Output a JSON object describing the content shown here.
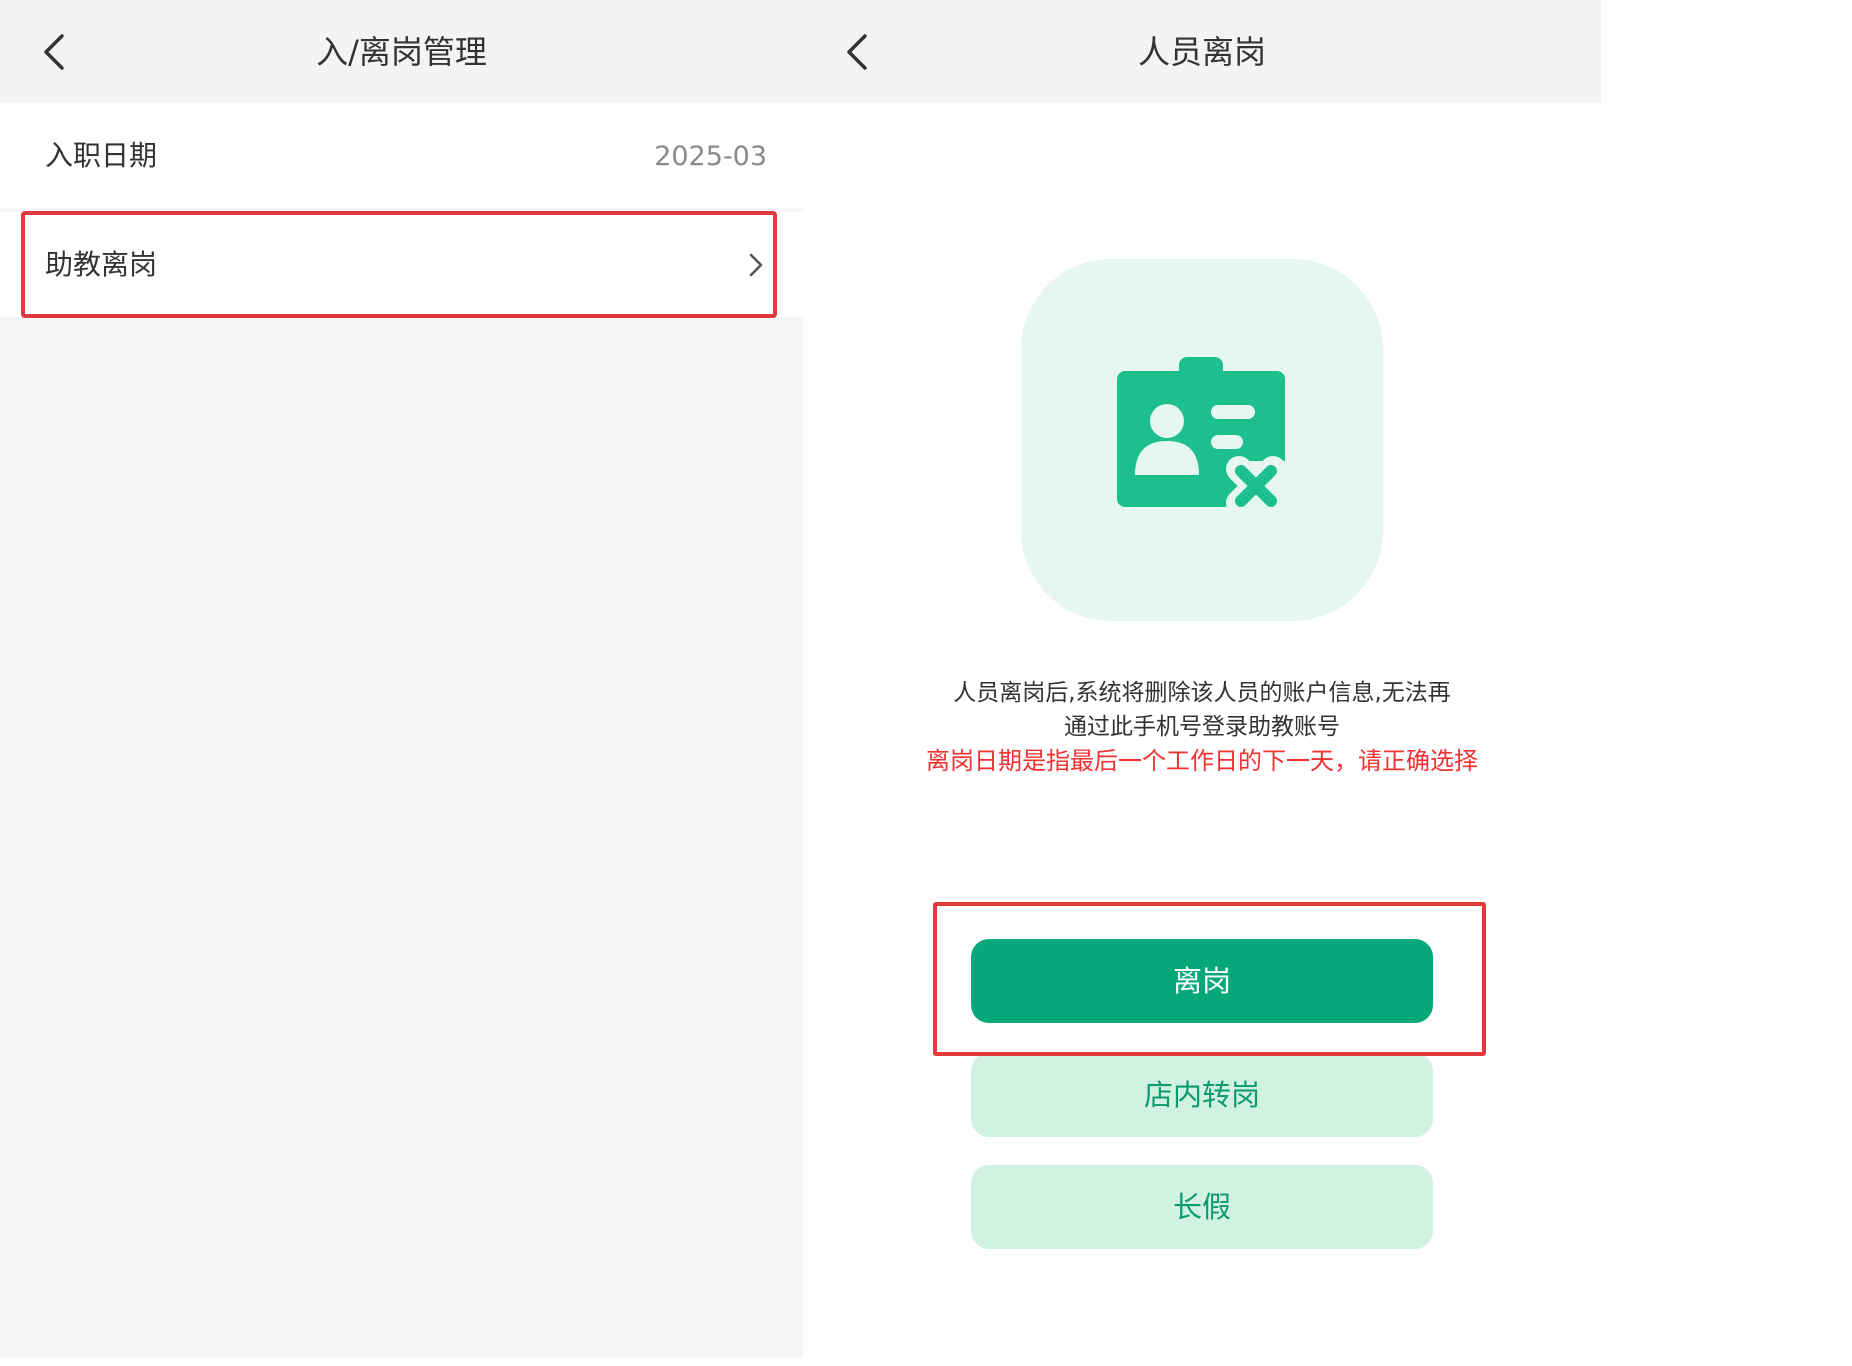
{
  "left_screen": {
    "nav": {
      "back_icon": "chevron-left-icon",
      "title": "入/离岗管理"
    },
    "hire_row": {
      "label": "入职日期",
      "value": "2025-03"
    },
    "leave_row": {
      "label": "助教离岗",
      "arrow_icon": "chevron-right-icon"
    }
  },
  "right_screen": {
    "nav": {
      "back_icon": "chevron-left-icon",
      "title": "人员离岗"
    },
    "illustration_icon": "id-card-remove-icon",
    "description": {
      "line1": "人员离岗后,系统将删除该人员的账户信息,无法再",
      "line2": "通过此手机号登录助教账号",
      "warning": "离岗日期是指最后一个工作日的下一天，请正确选择"
    },
    "buttons": {
      "leave": "离岗",
      "transfer": "店内转岗",
      "long_leave": "长假"
    }
  },
  "colors": {
    "accent": "#06a87a",
    "accent_light": "#d1f1e3",
    "icon_green": "#1dc08c",
    "illustration_bg": "#e6f7f1",
    "warning_red": "#f03232",
    "highlight_red": "#e2383b",
    "nav_bg": "#f4f4f6",
    "page_bg": "#f5f6f8"
  }
}
